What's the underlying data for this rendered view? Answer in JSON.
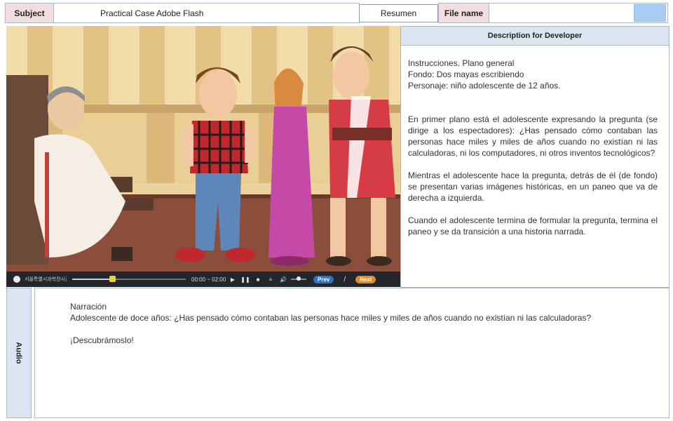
{
  "header": {
    "subject_label": "Subject",
    "subject_value": "Practical Case Adobe Flash",
    "resumen": "Resumen",
    "file_name_label": "File name",
    "file_name_value": ""
  },
  "video": {
    "brand_text": "서울특별시과학전시관",
    "time": "00:00 ~ 02:00",
    "progress_fraction": 0.35,
    "volume_fraction": 0.5,
    "prev_label": "Prev",
    "separator": "/",
    "next_label": "Next"
  },
  "description": {
    "title": "Description for Developer",
    "lines": [
      "Instrucciones. Plano general",
      "Fondo: Dos mayas escribiendo",
      "Personaje: niño adolescente de 12 años."
    ],
    "paragraphs": [
      "En primer plano está el adolescente expresando la pregunta (se dirige a los espectadores): ¿Has pensado cómo contaban las personas hace miles y miles de años cuando no existían ni las calculadoras, ni los computadores, ni otros inventos tecnológicos?",
      "Mientras el adolescente hace la pregunta, detrás de él (de fondo) se presentan varias imágenes históricas, en un paneo que va de derecha a izquierda.",
      "Cuando el adolescente termina de formular la pregunta, termina el paneo y se da transición a una historia narrada."
    ]
  },
  "audio": {
    "label": "Audio",
    "heading": "Narración",
    "line": "Adolescente de doce años: ¿Has pensado cómo contaban las personas hace miles y miles de años cuando no existían ni las calculadoras?",
    "closing": "¡Descubrámoslo!"
  },
  "colors": {
    "label_pink": "#f2dedf",
    "panel_blue": "#dbe5f1",
    "accent_blue": "#a8cdf5",
    "prev_blue": "#2f6fcf",
    "next_orange": "#e8881c"
  }
}
